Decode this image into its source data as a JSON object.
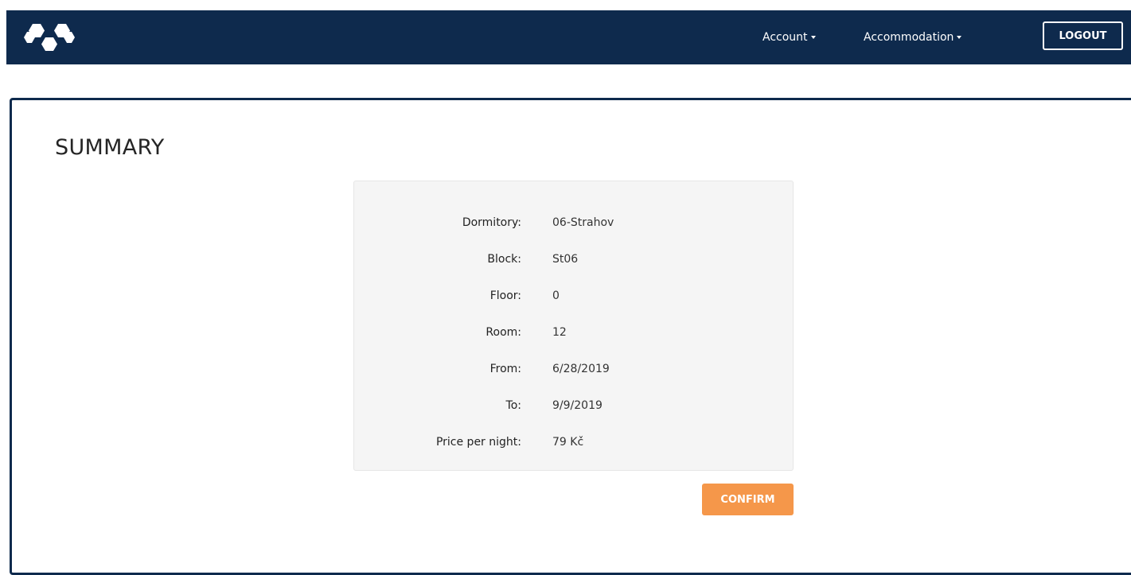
{
  "header": {
    "logo_icon": "hexagon-cluster-logo",
    "nav": [
      {
        "label": "Account"
      },
      {
        "label": "Accommodation"
      }
    ],
    "logout_label": "LOGOUT"
  },
  "main": {
    "title": "SUMMARY",
    "summary": [
      {
        "label": "Dormitory:",
        "value": "06-Strahov"
      },
      {
        "label": "Block:",
        "value": "St06"
      },
      {
        "label": "Floor:",
        "value": "0"
      },
      {
        "label": "Room:",
        "value": "12"
      },
      {
        "label": "From:",
        "value": "6/28/2019"
      },
      {
        "label": "To:",
        "value": "9/9/2019"
      },
      {
        "label": "Price per night:",
        "value": "79 Kč"
      }
    ],
    "confirm_label": "CONFIRM"
  },
  "colors": {
    "navbar_bg": "#0e2a4d",
    "accent": "#f5974a",
    "card_bg": "#f5f5f5"
  }
}
